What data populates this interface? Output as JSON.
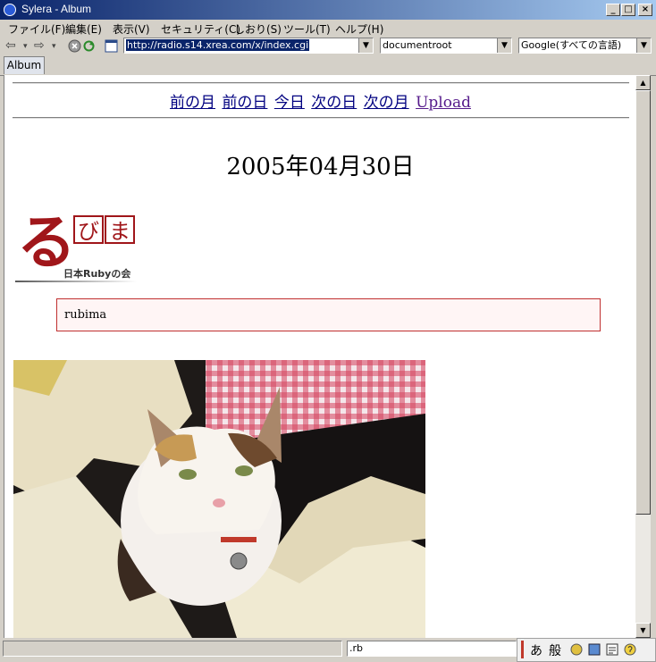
{
  "window": {
    "app_title": "Sylera - Album"
  },
  "menu": [
    "ファイル(F)",
    "編集(E)",
    "表示(V)",
    "セキュリティ(C)",
    "しおり(S)",
    "ツール(T)",
    "ヘルプ(H)"
  ],
  "toolbar": {
    "back_glyph": "⇦",
    "forward_glyph": "⇨",
    "url": "http://radio.s14.xrea.com/x/index.cgi",
    "location_combo": "documentroot",
    "search_combo": "Google(すべての言語)"
  },
  "tabs": [
    {
      "label": "Album"
    }
  ],
  "page": {
    "nav_links": [
      "前の月",
      "前の日",
      "今日",
      "次の日",
      "次の月",
      "Upload"
    ],
    "date_heading": "2005年04月30日",
    "logo": {
      "char_big": "る",
      "char_box1": "び",
      "char_box2": "ま",
      "caption": "日本Rubyの会"
    },
    "note_text": "rubima"
  },
  "status": {
    "field_text": ".rb"
  },
  "ime": {
    "mode": "あ",
    "dict": "般"
  },
  "colors": {
    "titlebar_start": "#0a246a",
    "link": "#000080",
    "logo_red": "#a0161a",
    "note_border": "#c03030"
  }
}
